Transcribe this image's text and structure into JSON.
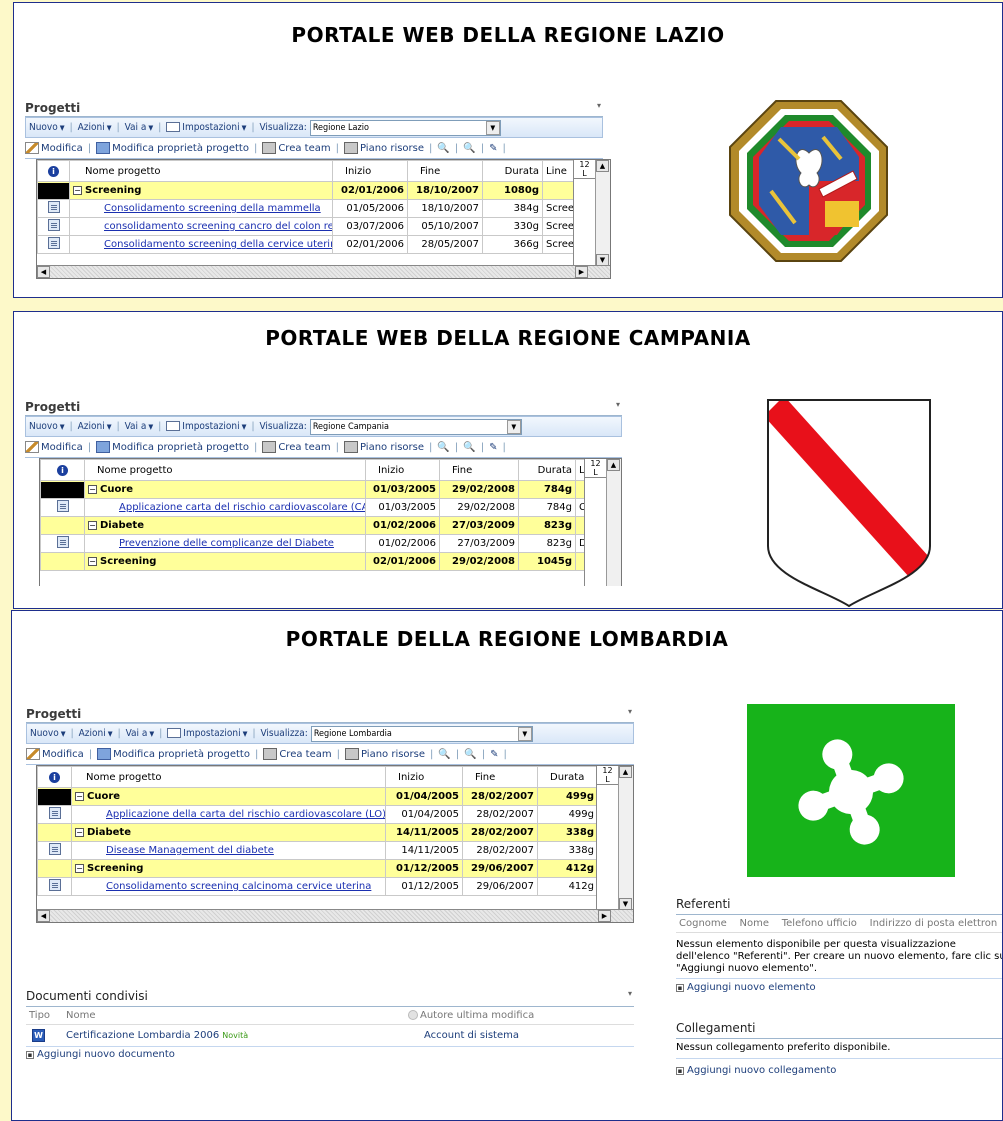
{
  "common": {
    "section_label": "Progetti",
    "toolbar": {
      "nuovo": "Nuovo",
      "azioni": "Azioni",
      "vai_a": "Vai a",
      "impostazioni": "Impostazioni",
      "visualizza": "Visualizza:"
    },
    "toolbar2": {
      "modifica": "Modifica",
      "modifica_proprieta": "Modifica proprietà progetto",
      "crea_team": "Crea team",
      "piano_risorse": "Piano risorse"
    },
    "columns": {
      "nome": "Nome progetto",
      "inizio": "Inizio",
      "fine": "Fine",
      "durata": "Durata"
    },
    "zoom_value": "12",
    "zoom_unit": "L"
  },
  "lazio": {
    "title": "PORTALE WEB DELLA REGIONE LAZIO",
    "view": "Regione Lazio",
    "line_col": "Line",
    "rows": [
      {
        "type": "sum",
        "name": "Screening",
        "start": "02/01/2006",
        "end": "18/10/2007",
        "dur": "1080g",
        "line": ""
      },
      {
        "type": "item",
        "name": "Consolidamento screening della mammella",
        "start": "01/05/2006",
        "end": "18/10/2007",
        "dur": "384g",
        "line": "Scree"
      },
      {
        "type": "item",
        "name": "consolidamento screening cancro del colon retto",
        "start": "03/07/2006",
        "end": "05/10/2007",
        "dur": "330g",
        "line": "Scree"
      },
      {
        "type": "item",
        "name": "Consolidamento screening della cervice uterina",
        "start": "02/01/2006",
        "end": "28/05/2007",
        "dur": "366g",
        "line": "Scree"
      }
    ]
  },
  "campania": {
    "title": "PORTALE WEB DELLA REGIONE CAMPANIA",
    "view": "Regione Campania",
    "line_col": "Li",
    "rows": [
      {
        "type": "sum",
        "name": "Cuore",
        "start": "01/03/2005",
        "end": "29/02/2008",
        "dur": "784g",
        "line": ""
      },
      {
        "type": "item",
        "name": "Applicazione carta del rischio cardiovascolare (CA)",
        "start": "01/03/2005",
        "end": "29/02/2008",
        "dur": "784g",
        "line": "Cuo"
      },
      {
        "type": "sum",
        "name": "Diabete",
        "start": "01/02/2006",
        "end": "27/03/2009",
        "dur": "823g",
        "line": ""
      },
      {
        "type": "item",
        "name": "Prevenzione delle complicanze del Diabete",
        "start": "01/02/2006",
        "end": "27/03/2009",
        "dur": "823g",
        "line": "Diab"
      },
      {
        "type": "sum",
        "name": "Screening",
        "start": "02/01/2006",
        "end": "29/02/2008",
        "dur": "1045g",
        "line": ""
      }
    ]
  },
  "lombardia": {
    "title": "PORTALE DELLA REGIONE LOMBARDIA",
    "view": "Regione Lombardia",
    "rows": [
      {
        "type": "sum",
        "name": "Cuore",
        "start": "01/04/2005",
        "end": "28/02/2007",
        "dur": "499g"
      },
      {
        "type": "item",
        "name": "Applicazione della carta del rischio cardiovascolare (LO)",
        "start": "01/04/2005",
        "end": "28/02/2007",
        "dur": "499g"
      },
      {
        "type": "sum",
        "name": "Diabete",
        "start": "14/11/2005",
        "end": "28/02/2007",
        "dur": "338g"
      },
      {
        "type": "item",
        "name": "Disease Management del diabete",
        "start": "14/11/2005",
        "end": "28/02/2007",
        "dur": "338g"
      },
      {
        "type": "sum",
        "name": "Screening",
        "start": "01/12/2005",
        "end": "29/06/2007",
        "dur": "412g"
      },
      {
        "type": "item",
        "name": "Consolidamento screening calcinoma cervice uterina",
        "start": "01/12/2005",
        "end": "29/06/2007",
        "dur": "412g"
      }
    ],
    "documenti": {
      "title": "Documenti condivisi",
      "col_tipo": "Tipo",
      "col_nome": "Nome",
      "col_autore": "Autore ultima modifica",
      "doc_name": "Certificazione Lombardia 2006",
      "doc_badge": "Novità",
      "doc_author": "Account di sistema",
      "add": "Aggiungi nuovo documento"
    },
    "referenti": {
      "title": "Referenti",
      "cols": [
        "Cognome",
        "Nome",
        "Telefono ufficio",
        "Indirizzo di posta elettron"
      ],
      "msg": "Nessun elemento disponibile per questa visualizzazione dell'elenco \"Referenti\". Per creare un nuovo elemento, fare clic su \"Aggiungi nuovo elemento\".",
      "add": "Aggiungi nuovo elemento"
    },
    "collegamenti": {
      "title": "Collegamenti",
      "msg": "Nessun collegamento preferito disponibile.",
      "add": "Aggiungi nuovo collegamento"
    }
  },
  "colors": {
    "summary_row": "#ffff9a",
    "link": "#1a2fb0",
    "page_bg": "#fdf9c9",
    "lombardia_green": "#17b31a"
  }
}
